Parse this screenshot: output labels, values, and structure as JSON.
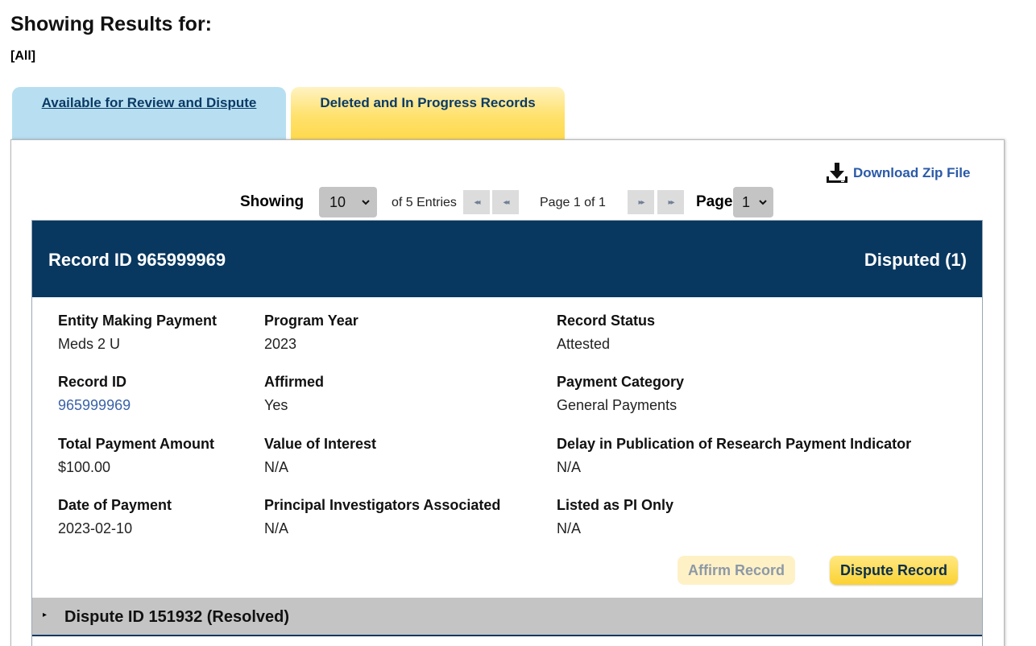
{
  "header": {
    "title": "Showing Results for:",
    "filter": "[All]"
  },
  "tabs": [
    {
      "label": "Available for Review and Dispute"
    },
    {
      "label": "Deleted and In Progress Records"
    }
  ],
  "download": {
    "label": "Download Zip File",
    "icon": "download-icon"
  },
  "pagination": {
    "showing_label": "Showing",
    "page_size": "10",
    "entries_text": "of 5 Entries",
    "page_text": "Page 1 of 1",
    "page_label": "Page",
    "page_value": "1",
    "first_icon": "◂◂",
    "prev_icon": "◂◂",
    "next_icon": "▸▸",
    "last_icon": "▸▸"
  },
  "record": {
    "title": "Record ID 965999969",
    "status_summary": "Disputed (1)",
    "fields": {
      "entity": {
        "label": "Entity Making Payment",
        "value": "Meds 2 U"
      },
      "program_year": {
        "label": "Program Year",
        "value": "2023"
      },
      "record_status": {
        "label": "Record Status",
        "value": "Attested"
      },
      "record_id": {
        "label": "Record ID",
        "value": "965999969"
      },
      "affirmed": {
        "label": "Affirmed",
        "value": "Yes"
      },
      "payment_category": {
        "label": "Payment Category",
        "value": "General Payments"
      },
      "total_payment": {
        "label": "Total Payment Amount",
        "value": "$100.00"
      },
      "value_of_interest": {
        "label": "Value of Interest",
        "value": "N/A"
      },
      "delay_indicator": {
        "label": "Delay in Publication of Research Payment Indicator",
        "value": "N/A"
      },
      "date_of_payment": {
        "label": "Date of Payment",
        "value": "2023-02-10"
      },
      "principal_investigators": {
        "label": "Principal Investigators Associated",
        "value": "N/A"
      },
      "listed_pi_only": {
        "label": "Listed as PI Only",
        "value": "N/A"
      }
    },
    "affirm_label": "Affirm Record",
    "dispute_label": "Dispute Record"
  },
  "dispute": {
    "toggle_icon": "▸",
    "label": "Dispute ID 151932 (Resolved)"
  },
  "colors": {
    "header_navy": "#08375f",
    "tab_blue": "#b7dff1",
    "tab_yellow": "#ffd94d",
    "link_blue": "#3a62a8"
  }
}
